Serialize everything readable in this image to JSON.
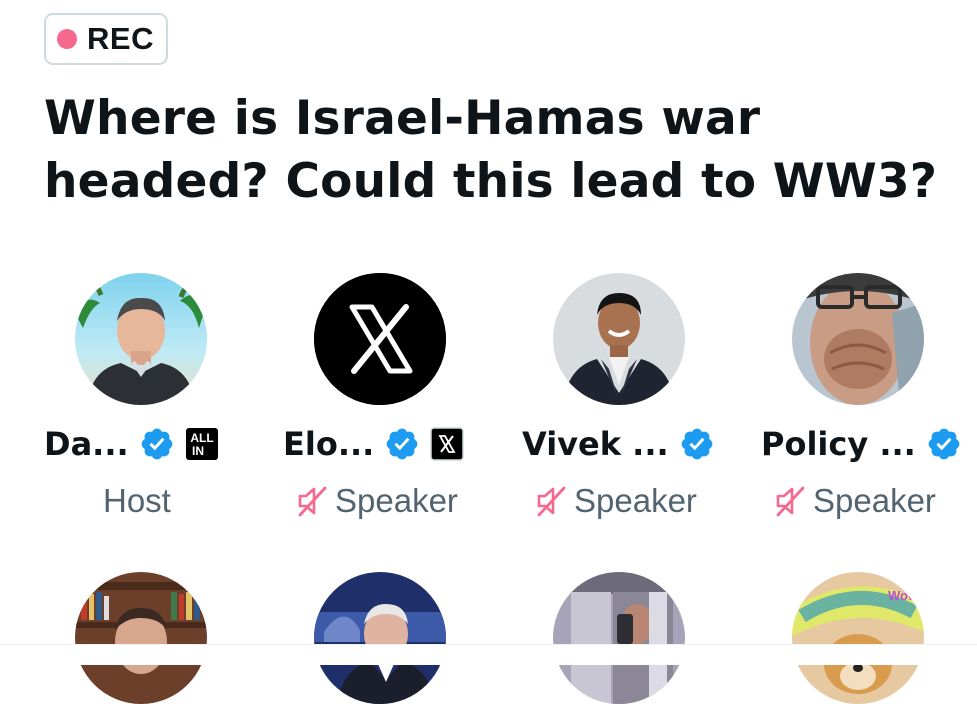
{
  "recording": {
    "label": "REC",
    "dot_color": "#f4698d"
  },
  "space": {
    "title_line1": "Where is Israel-Hamas war",
    "title_line2": "headed? Could this lead to WW3?"
  },
  "participants": [
    {
      "name": "Da...",
      "role": "Host",
      "verified": true,
      "affiliate_badge": "ALL IN",
      "muted": false
    },
    {
      "name": "Elo...",
      "role": "Speaker",
      "verified": true,
      "affiliate_badge": "X",
      "muted": true
    },
    {
      "name": "Vivek ...",
      "role": "Speaker",
      "verified": true,
      "muted": true
    },
    {
      "name": "Policy ...",
      "role": "Speaker",
      "verified": true,
      "muted": true
    }
  ],
  "colors": {
    "verified_blue": "#1d9bf0",
    "muted_red": "#f4698d",
    "secondary_text": "#536471"
  },
  "icons": [
    "verified-badge-icon",
    "mic-muted-icon",
    "x-logo-icon",
    "all-in-logo-icon"
  ],
  "second_row_doge_text": "Wow"
}
